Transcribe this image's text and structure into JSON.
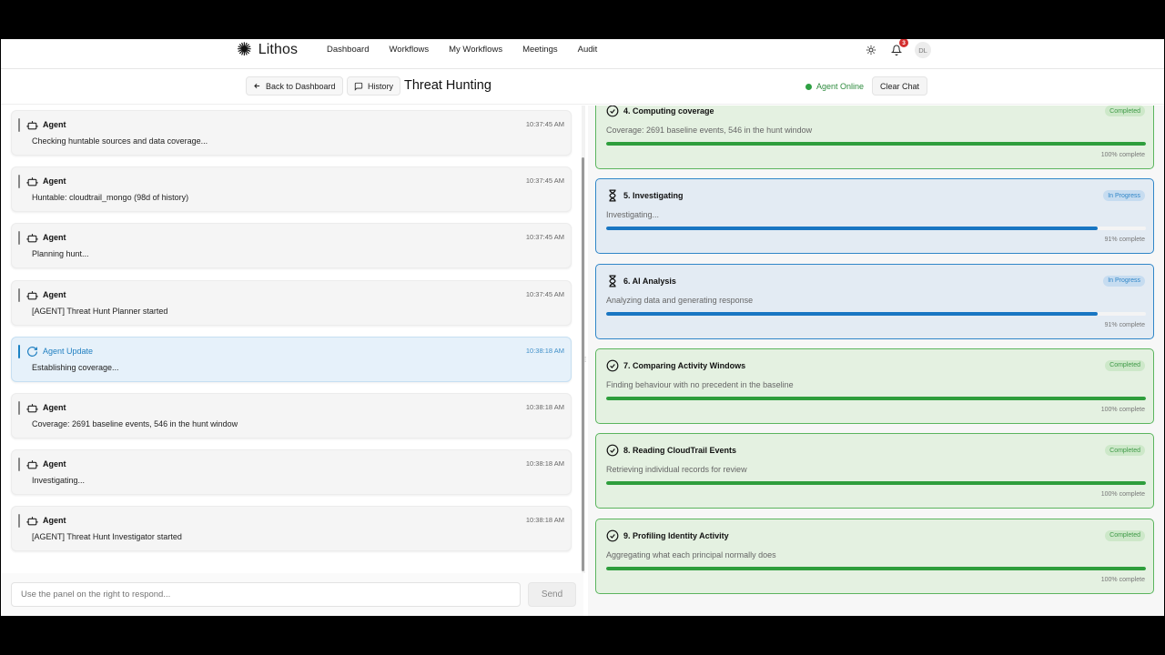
{
  "app": {
    "brand": "Lithos"
  },
  "nav": {
    "links": [
      "Dashboard",
      "Workflows",
      "My Workflows",
      "Meetings",
      "Audit"
    ],
    "notification_count": "3",
    "avatar_initials": "DL"
  },
  "header": {
    "back_label": "Back to Dashboard",
    "history_label": "History",
    "title": "Threat Hunting",
    "status": "Agent Online",
    "clear_label": "Clear Chat"
  },
  "messages": [
    {
      "who": "Agent",
      "time": "10:37:45 AM",
      "text": "Checking huntable sources and data coverage...",
      "kind": "agent"
    },
    {
      "who": "Agent",
      "time": "10:37:45 AM",
      "text": "Huntable: cloudtrail_mongo (98d of history)",
      "kind": "agent"
    },
    {
      "who": "Agent",
      "time": "10:37:45 AM",
      "text": "Planning hunt...",
      "kind": "agent"
    },
    {
      "who": "Agent",
      "time": "10:37:45 AM",
      "text": "[AGENT] Threat Hunt Planner started",
      "kind": "agent"
    },
    {
      "who": "Agent Update",
      "time": "10:38:18 AM",
      "text": "Establishing coverage...",
      "kind": "update"
    },
    {
      "who": "Agent",
      "time": "10:38:18 AM",
      "text": "Coverage: 2691 baseline events, 546 in the hunt window",
      "kind": "agent"
    },
    {
      "who": "Agent",
      "time": "10:38:18 AM",
      "text": "Investigating...",
      "kind": "agent"
    },
    {
      "who": "Agent",
      "time": "10:38:18 AM",
      "text": "[AGENT] Threat Hunt Investigator started",
      "kind": "agent"
    }
  ],
  "composer": {
    "placeholder": "Use the panel on the right to respond...",
    "send_label": "Send"
  },
  "steps": [
    {
      "name": "4. Computing coverage",
      "status": "Completed",
      "desc": "Coverage: 2691 baseline events, 546 in the hunt window",
      "progress": 100,
      "pct_label": "100% complete",
      "state": "done"
    },
    {
      "name": "5. Investigating",
      "status": "In Progress",
      "desc": "Investigating...",
      "progress": 91,
      "pct_label": "91% complete",
      "state": "prog"
    },
    {
      "name": "6. AI Analysis",
      "status": "In Progress",
      "desc": "Analyzing data and generating response",
      "progress": 91,
      "pct_label": "91% complete",
      "state": "prog"
    },
    {
      "name": "7. Comparing Activity Windows",
      "status": "Completed",
      "desc": "Finding behaviour with no precedent in the baseline",
      "progress": 100,
      "pct_label": "100% complete",
      "state": "done"
    },
    {
      "name": "8. Reading CloudTrail Events",
      "status": "Completed",
      "desc": "Retrieving individual records for review",
      "progress": 100,
      "pct_label": "100% complete",
      "state": "done"
    },
    {
      "name": "9. Profiling Identity Activity",
      "status": "Completed",
      "desc": "Aggregating what each principal normally does",
      "progress": 100,
      "pct_label": "100% complete",
      "state": "done"
    }
  ],
  "colors": {
    "online": "#2ea043",
    "completed": "#2e9e3c",
    "in_progress": "#1976c2"
  }
}
